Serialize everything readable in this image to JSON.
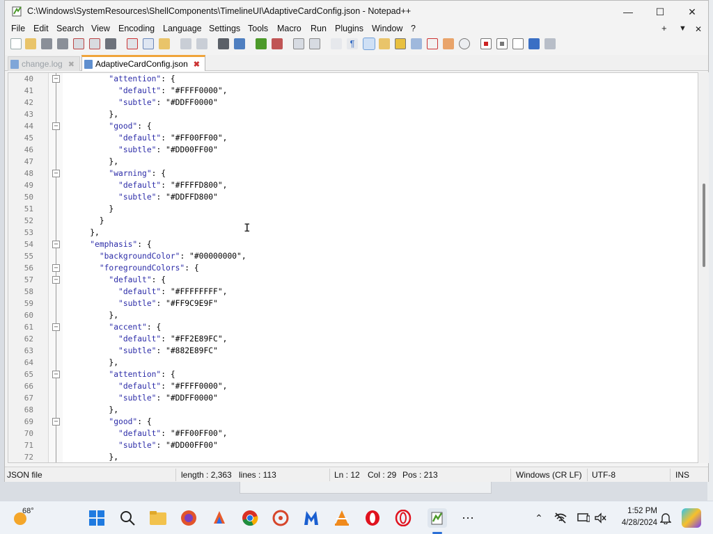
{
  "window": {
    "title": "C:\\Windows\\SystemResources\\ShellComponents\\TimelineUI\\AdaptiveCardConfig.json - Notepad++"
  },
  "menu": [
    "File",
    "Edit",
    "Search",
    "View",
    "Encoding",
    "Language",
    "Settings",
    "Tools",
    "Macro",
    "Run",
    "Plugins",
    "Window",
    "?"
  ],
  "menu_right": {
    "add": "+",
    "dropdown": "▼",
    "close": "✕"
  },
  "tabs": [
    {
      "label": "change.log",
      "active": false
    },
    {
      "label": "AdaptiveCardConfig.json",
      "active": true
    }
  ],
  "lines": [
    {
      "n": "40",
      "fold": true,
      "code": "        \"attention\": {"
    },
    {
      "n": "41",
      "fold": false,
      "code": "          \"default\": \"#FFFF0000\","
    },
    {
      "n": "42",
      "fold": false,
      "code": "          \"subtle\": \"#DDFF0000\""
    },
    {
      "n": "43",
      "fold": false,
      "code": "        },"
    },
    {
      "n": "44",
      "fold": true,
      "code": "        \"good\": {"
    },
    {
      "n": "45",
      "fold": false,
      "code": "          \"default\": \"#FF00FF00\","
    },
    {
      "n": "46",
      "fold": false,
      "code": "          \"subtle\": \"#DD00FF00\""
    },
    {
      "n": "47",
      "fold": false,
      "code": "        },"
    },
    {
      "n": "48",
      "fold": true,
      "code": "        \"warning\": {"
    },
    {
      "n": "49",
      "fold": false,
      "code": "          \"default\": \"#FFFFD800\","
    },
    {
      "n": "50",
      "fold": false,
      "code": "          \"subtle\": \"#DDFFD800\""
    },
    {
      "n": "51",
      "fold": false,
      "code": "        }"
    },
    {
      "n": "52",
      "fold": false,
      "code": "      }"
    },
    {
      "n": "53",
      "fold": false,
      "code": "    },"
    },
    {
      "n": "54",
      "fold": true,
      "code": "    \"emphasis\": {"
    },
    {
      "n": "55",
      "fold": false,
      "code": "      \"backgroundColor\": \"#00000000\","
    },
    {
      "n": "56",
      "fold": true,
      "code": "      \"foregroundColors\": {"
    },
    {
      "n": "57",
      "fold": true,
      "code": "        \"default\": {"
    },
    {
      "n": "58",
      "fold": false,
      "code": "          \"default\": \"#FFFFFFFF\","
    },
    {
      "n": "59",
      "fold": false,
      "code": "          \"subtle\": \"#FF9C9E9F\""
    },
    {
      "n": "60",
      "fold": false,
      "code": "        },"
    },
    {
      "n": "61",
      "fold": true,
      "code": "        \"accent\": {"
    },
    {
      "n": "62",
      "fold": false,
      "code": "          \"default\": \"#FF2E89FC\","
    },
    {
      "n": "63",
      "fold": false,
      "code": "          \"subtle\": \"#882E89FC\""
    },
    {
      "n": "64",
      "fold": false,
      "code": "        },"
    },
    {
      "n": "65",
      "fold": true,
      "code": "        \"attention\": {"
    },
    {
      "n": "66",
      "fold": false,
      "code": "          \"default\": \"#FFFF0000\","
    },
    {
      "n": "67",
      "fold": false,
      "code": "          \"subtle\": \"#DDFF0000\""
    },
    {
      "n": "68",
      "fold": false,
      "code": "        },"
    },
    {
      "n": "69",
      "fold": true,
      "code": "        \"good\": {"
    },
    {
      "n": "70",
      "fold": false,
      "code": "          \"default\": \"#FF00FF00\","
    },
    {
      "n": "71",
      "fold": false,
      "code": "          \"subtle\": \"#DD00FF00\""
    },
    {
      "n": "72",
      "fold": false,
      "code": "        },"
    }
  ],
  "status": {
    "filetype": "JSON file",
    "length": "length : 2,363",
    "lines": "lines : 113",
    "ln": "Ln : 12",
    "col": "Col : 29",
    "pos": "Pos : 213",
    "eol": "Windows (CR LF)",
    "encoding": "UTF-8",
    "mode": "INS"
  },
  "taskbar": {
    "weather_temp": "68°",
    "time": "1:52 PM",
    "date": "4/28/2024",
    "pinned": [
      "start-icon",
      "search-icon",
      "file-explorer-icon",
      "firefox-icon",
      "app-icon-1",
      "chrome-icon",
      "app-icon-2",
      "malwarebytes-icon",
      "vlc-icon",
      "opera-icon",
      "opera-gx-icon",
      "notepadpp-icon",
      "more-icon"
    ]
  },
  "colors": {
    "accent_tab": "#f0a43a",
    "keyword": "#2c2ca8"
  }
}
